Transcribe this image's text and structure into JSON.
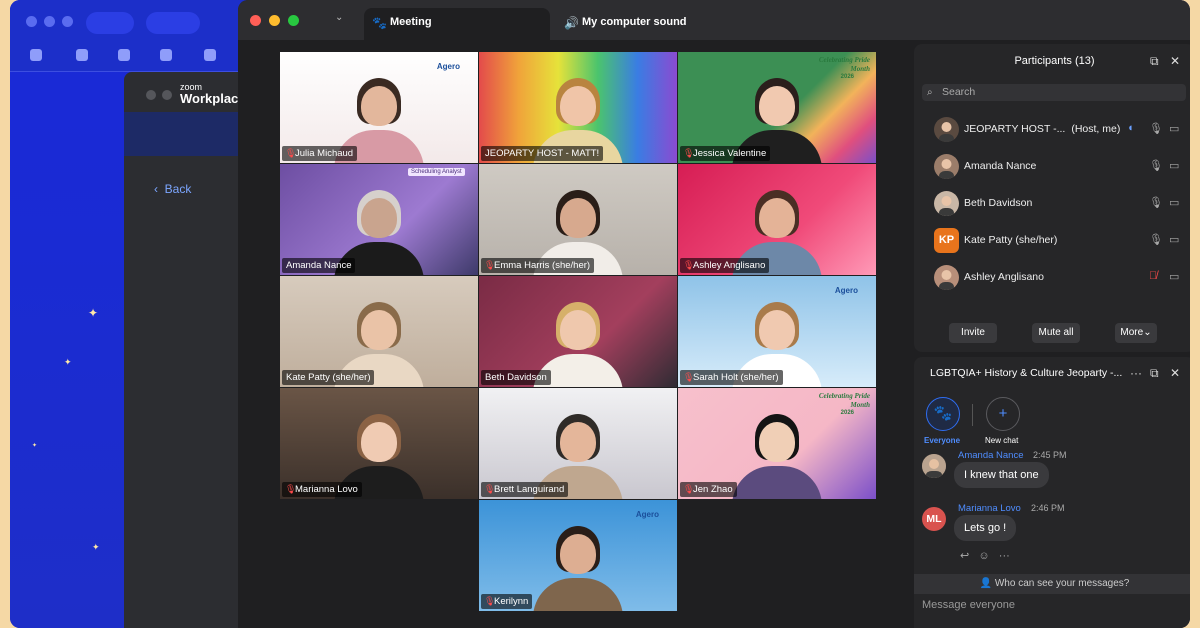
{
  "meeting_tabs": [
    {
      "label": "Meeting",
      "icon": "paw-icon"
    },
    {
      "label": "My computer sound",
      "icon": "speaker-icon"
    }
  ],
  "zoom_workplace": {
    "logo_top": "zoom",
    "logo_bottom": "Workplace",
    "back": "Back"
  },
  "tiles": [
    {
      "name": "Julia Michaud",
      "muted": true,
      "brand": "Agero"
    },
    {
      "name": "JEOPARTY HOST - MATT!",
      "muted": false,
      "active": true
    },
    {
      "name": "Jessica Valentine",
      "muted": true,
      "banner": "Celebrating Pride Month",
      "year": "2026"
    },
    {
      "name": "Amanda Nance",
      "muted": false,
      "sign": "Scheduling Analyst"
    },
    {
      "name": "Emma Harris (she/her)",
      "muted": true
    },
    {
      "name": "Ashley Anglisano",
      "muted": true
    },
    {
      "name": "Kate Patty (she/her)",
      "muted": false
    },
    {
      "name": "Beth Davidson",
      "muted": false
    },
    {
      "name": "Sarah Holt (she/her)",
      "muted": true,
      "brand": "Agero"
    },
    {
      "name": "Marianna Lovo",
      "muted": true
    },
    {
      "name": "Brett Languirand",
      "muted": true
    },
    {
      "name": "Jen Zhao",
      "muted": true,
      "banner": "Celebrating Pride Month",
      "year": "2026"
    },
    {
      "name": "Kerilynn",
      "muted": true,
      "brand": "Agero"
    }
  ],
  "participants": {
    "title": "Participants (13)",
    "search_placeholder": "Search",
    "rows": [
      {
        "name": "JEOPARTY HOST -...",
        "tag": "(Host, me)",
        "initials": "",
        "mic": "speaking"
      },
      {
        "name": "Amanda Nance",
        "tag": "",
        "initials": "",
        "mic": "on"
      },
      {
        "name": "Beth Davidson",
        "tag": "",
        "initials": "",
        "mic": "on"
      },
      {
        "name": "Kate Patty (she/her)",
        "tag": "",
        "initials": "KP",
        "mic": "on"
      },
      {
        "name": "Ashley Anglisano",
        "tag": "",
        "initials": "",
        "mic": "muted"
      }
    ],
    "buttons": {
      "invite": "Invite",
      "mute_all": "Mute all",
      "more": "More"
    }
  },
  "chat": {
    "title": "LGBTQIA+ History & Culture Jeoparty -...",
    "targets": [
      {
        "label": "Everyone",
        "selected": true
      },
      {
        "label": "New chat",
        "selected": false
      }
    ],
    "messages": [
      {
        "sender": "Amanda Nance",
        "time": "2:45 PM",
        "text": "I knew that one",
        "initials": ""
      },
      {
        "sender": "Marianna Lovo",
        "time": "2:46 PM",
        "text": "Lets go !",
        "initials": "ML"
      }
    ],
    "visibility": "Who can see your messages?",
    "input_placeholder": "Message everyone"
  },
  "colors": {
    "accent": "#2f6df2",
    "active_speaker": "#35c759",
    "muted_red": "#ff4b4b",
    "kp_avatar": "#e8741c",
    "ml_avatar": "#d9534f"
  }
}
